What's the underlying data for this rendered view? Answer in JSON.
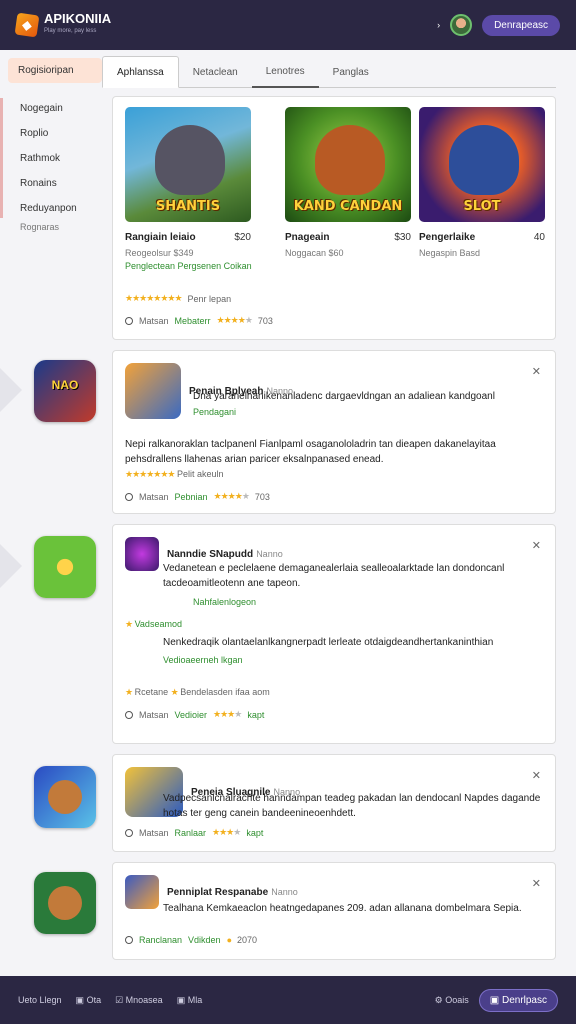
{
  "header": {
    "brand": "APIKONIIA",
    "brand_sub": "Play more, pay less",
    "chevron": "›",
    "button": "Denrapeasc"
  },
  "sidebar": {
    "active": "Rogisioripan",
    "items": [
      "Nogegain",
      "Roplio",
      "Rathmok",
      "Ronains",
      "Reduyanpon"
    ],
    "footnote": "Rognaras"
  },
  "tabs": [
    "Aphlanssa",
    "Netaclean",
    "Lenotres",
    "Panglas"
  ],
  "featured": {
    "games": [
      {
        "art": "SHANTIS",
        "name": "Rangiain leiaio",
        "price": "$20",
        "sub": "Reogeolsur $349"
      },
      {
        "art": "KAND CANDAN",
        "name": "Pnageain",
        "price": "$30",
        "sub": "Noggacan $60"
      },
      {
        "art": "SLOT",
        "name": "Pengerlaike",
        "price": "40",
        "sub": "Negaspin Basd"
      }
    ],
    "promo": "Penglectean Pergsenen Coikan",
    "rating_row": "Penr lepan",
    "foot_label": "Matsan",
    "foot_green": "Mebaterr",
    "foot_count": "703"
  },
  "reviews": [
    {
      "name": "Penain Bplyeah",
      "tag": "Nanno",
      "text": "Dna yaranelnanikenanladenc dargaevldngan an adaliean kandgoanl",
      "sub": "Pendagani",
      "body": "Nepi ralkanoraklan taclpanenl Fianlpaml osaganololadrin tan dieapen dakanelayitaa pehsdrallens llahenas arian paricer eksalnpanased enead.",
      "rating_label": "Pelit akeuln",
      "foot_label": "Matsan",
      "foot_green": "Pebnian",
      "foot_count": "703"
    },
    {
      "name": "Nanndie SNapudd",
      "tag": "Nanno",
      "text": "Vedanetean e peclelaene demaganealerlaia sealleoalarktade lan dondoncanl tacdeoamitleotenn ane tapeon.",
      "sub": "Nahfalenlogeon",
      "reply_label": "Vadseamod",
      "reply_text": "Nenkedraqik olantaelanlkangnerpadt lerleate otdaigdeandhertankaninthian",
      "reply_green": "Vedioaeerneh lkgan",
      "rating_label": "Rcetane",
      "rating_tail": "Bendelasden ifaa aom",
      "foot_label": "Matsan",
      "foot_green": "Vedioier",
      "foot_count": "kapt"
    },
    {
      "name": "Peneia Sluagnile",
      "tag": "Nanno",
      "text": "Vadpecsanlcnalrachte hanndampan teadeg pakadan lan dendocanl Napdes dagande hotas ter geng canein bandeenineoenhdett.",
      "foot_label": "Matsan",
      "foot_green": "Ranlaar",
      "foot_count": "kapt"
    },
    {
      "name": "Penniplat Respanabe",
      "tag": "Nanno",
      "text": "Tealhana Kemkaeaclon heatngedapanes 209. adan allanana dombelmara Sepia.",
      "foot_label": "Ranclanan",
      "foot_green": "Vdikden",
      "foot_count": "2070"
    }
  ],
  "footer": {
    "items": [
      "Ueto Llegn",
      "Ota",
      "Mnoasea",
      "Mla"
    ],
    "right_label": "Ooais",
    "button": "Denrlpasc"
  },
  "colors": {
    "header_bg": "#2b2743",
    "accent": "#5b4aa8",
    "star": "#f2b01e",
    "green": "#2f8f2f"
  }
}
